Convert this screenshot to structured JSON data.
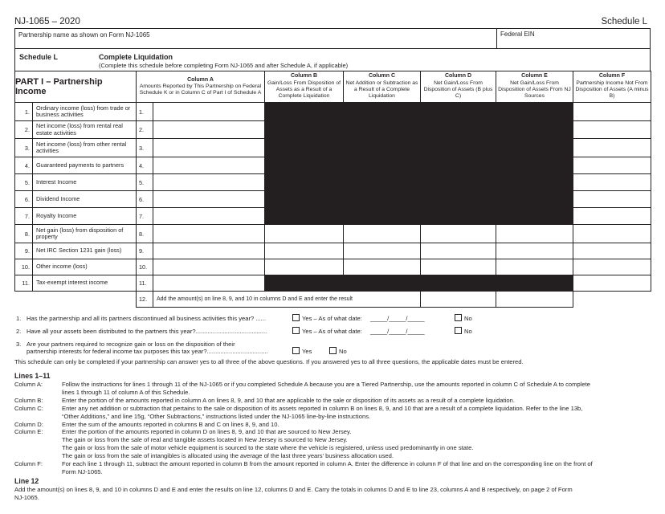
{
  "header": {
    "form_id": "NJ-1065 – 2020",
    "schedule": "Schedule L"
  },
  "info": {
    "partnership_name_label": "Partnership name as shown on Form NJ-1065",
    "partnership_name_value": "",
    "federal_ein_label": "Federal EIN",
    "federal_ein_value": ""
  },
  "schedule": {
    "label": "Schedule L",
    "title": "Complete Liquidation",
    "subtitle": "(Complete this schedule before completing Form NJ-1065 and after Schedule A, if applicable)"
  },
  "table": {
    "part_title": "PART I – Partnership Income",
    "columns": [
      {
        "key": "A",
        "title": "Column A",
        "desc": "Amounts Reported by This Partnership on Federal Schedule K or in Column C of Part I of Schedule A"
      },
      {
        "key": "B",
        "title": "Column B",
        "desc": "Gain/Loss From Disposition of Assets as a Result of a Complete Liquidation"
      },
      {
        "key": "C",
        "title": "Column C",
        "desc": "Net Addition or Subtraction as a Result of a Complete Liquidation"
      },
      {
        "key": "D",
        "title": "Column D",
        "desc": "Net Gain/Loss From Disposition of Assets (B plus C)"
      },
      {
        "key": "E",
        "title": "Column E",
        "desc": "Net Gain/Loss From Disposition of Assets From NJ Sources"
      },
      {
        "key": "F",
        "title": "Column F",
        "desc": "Partnership Income Not From Disposition of Assets (A minus B)"
      }
    ],
    "rows": [
      {
        "num": "1.",
        "desc": "Ordinary income (loss) from trade or business activities",
        "line": "1.",
        "blocked_bcde": true,
        "values": {
          "A": "",
          "F": ""
        }
      },
      {
        "num": "2.",
        "desc": "Net income (loss) from rental real estate activities",
        "line": "2.",
        "blocked_bcde": true,
        "values": {
          "A": "",
          "F": ""
        }
      },
      {
        "num": "3.",
        "desc": "Net income (loss) from other rental activities",
        "line": "3.",
        "blocked_bcde": true,
        "values": {
          "A": "",
          "F": ""
        }
      },
      {
        "num": "4.",
        "desc": "Guaranteed payments to partners",
        "line": "4.",
        "blocked_bcde": true,
        "values": {
          "A": "",
          "F": ""
        }
      },
      {
        "num": "5.",
        "desc": "Interest Income",
        "line": "5.",
        "blocked_bcde": true,
        "values": {
          "A": "",
          "F": ""
        }
      },
      {
        "num": "6.",
        "desc": "Dividend Income",
        "line": "6.",
        "blocked_bcde": true,
        "values": {
          "A": "",
          "F": ""
        }
      },
      {
        "num": "7.",
        "desc": "Royalty Income",
        "line": "7.",
        "blocked_bcde": true,
        "values": {
          "A": "",
          "F": ""
        }
      },
      {
        "num": "8.",
        "desc": "Net gain (loss) from disposition of property",
        "line": "8.",
        "blocked_bcde": false,
        "values": {
          "A": "",
          "B": "",
          "C": "",
          "D": "",
          "E": "",
          "F": ""
        }
      },
      {
        "num": "9.",
        "desc": "Net IRC Section 1231 gain (loss)",
        "line": "9.",
        "blocked_bcde": false,
        "values": {
          "A": "",
          "B": "",
          "C": "",
          "D": "",
          "E": "",
          "F": ""
        }
      },
      {
        "num": "10.",
        "desc": "Other income (loss)",
        "line": "10.",
        "blocked_bcde": false,
        "values": {
          "A": "",
          "B": "",
          "C": "",
          "D": "",
          "E": "",
          "F": ""
        }
      },
      {
        "num": "11.",
        "desc": "Tax-exempt interest income",
        "line": "11.",
        "blocked_bcde": true,
        "values": {
          "A": "",
          "F": ""
        }
      }
    ],
    "line12": {
      "line": "12.",
      "text": "Add the amount(s) on line 8, 9, and 10 in columns D and E and enter the result",
      "values": {
        "D": "",
        "E": ""
      }
    }
  },
  "questions": [
    {
      "num": "1.",
      "text": "Has the partnership and all its partners discontinued all business activities this year? ......",
      "yes_label": "Yes – As of what date:",
      "date_blank": "_____/_____/_____",
      "no_label": "No",
      "yes_checked": false,
      "no_checked": false
    },
    {
      "num": "2.",
      "text": "Have all your assets been distributed to the partners this year?..........................................",
      "yes_label": "Yes – As of what date:",
      "date_blank": "_____/_____/_____",
      "no_label": "No",
      "yes_checked": false,
      "no_checked": false
    },
    {
      "num": "3.",
      "text_line1": "Are your partners required to recognize gain or loss on the disposition of their",
      "text_line2": "partnership interests for federal income tax purposes this tax year?....................................",
      "yes_label": "Yes",
      "no_label": "No",
      "yes_checked": false,
      "no_checked": false
    }
  ],
  "note": "This schedule can only be completed if your partnership can answer yes to all three of the above questions. If you answered yes to all three questions, the applicable dates must be entered.",
  "instructions": {
    "lines_1_11_heading": "Lines 1–11",
    "items": [
      {
        "key": "Column A:",
        "lines": [
          "Follow the instructions for lines 1 through 11 of the NJ-1065 or if you completed Schedule A because you are a Tiered Partnership, use the amounts reported in column C of Schedule A to complete",
          "lines 1 through 11 of column A of this Schedule."
        ]
      },
      {
        "key": "Column B:",
        "lines": [
          "Enter the portion of the amounts reported in column A on lines 8, 9, and 10 that are applicable to the sale or disposition of its assets as a result of a complete liquidation."
        ]
      },
      {
        "key": "Column C:",
        "lines": [
          "Enter any net addition or subtraction that pertains to the sale or disposition of its assets reported in column B on lines 8, 9, and 10 that are a result of a complete liquidation. Refer to the line 13b,",
          "“Other Additions,” and line 15g, “Other Subtractions,” instructions listed under the NJ-1065 line-by-line instructions."
        ]
      },
      {
        "key": "Column D:",
        "lines": [
          "Enter the sum of the amounts reported in columns B and C on lines 8, 9, and 10."
        ]
      },
      {
        "key": "Column E:",
        "lines": [
          "Enter the portion of the amounts reported in column D on lines 8, 9, and 10 that are sourced to New Jersey.",
          "The gain or loss from the sale of real and tangible assets located in New Jersey is sourced to New Jersey.",
          "The gain or loss from the sale of motor vehicle equipment is sourced to the state where the vehicle is registered, unless used predominantly in one state.",
          "The gain or loss from the sale of intangibles is allocated using the average of the last three years’ business allocation used."
        ]
      },
      {
        "key": "Column F:",
        "lines": [
          "For each line 1 through 11, subtract the amount reported in column B from the amount reported in column A. Enter the difference in column F of that line and on the corresponding line on the front of",
          "Form NJ-1065."
        ]
      }
    ],
    "line12_heading": "Line 12",
    "line12_lines": [
      "Add the amount(s) on lines 8, 9, and 10 in columns D and E and enter the results on line 12, columns D and E. Carry the totals in columns D and E to line 23, columns A and B respectively, on page 2 of Form",
      "NJ-1065."
    ]
  },
  "colors": {
    "ink": "#231f20",
    "paper": "#ffffff"
  }
}
